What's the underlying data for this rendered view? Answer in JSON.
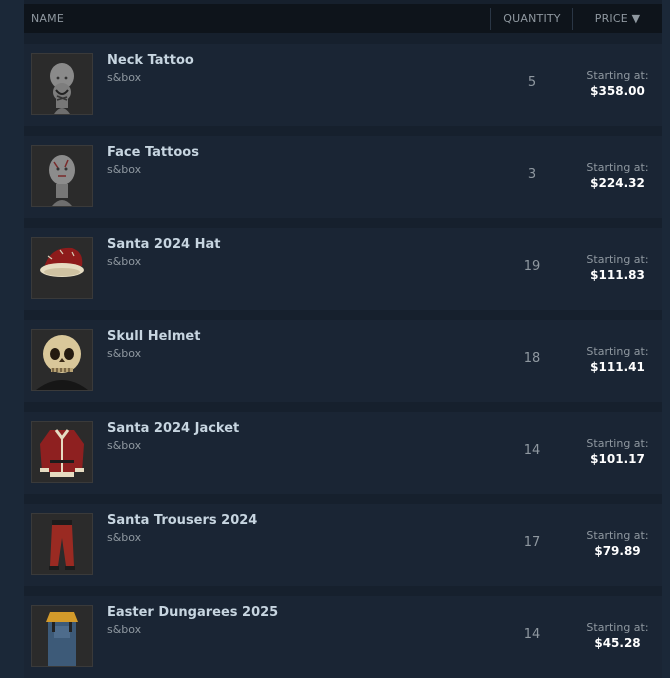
{
  "header": {
    "name": "NAME",
    "quantity": "QUANTITY",
    "price": "PRICE",
    "sort_indicator": "▼"
  },
  "price_label": "Starting at:",
  "items": [
    {
      "name": "Neck Tattoo",
      "game": "s&box",
      "quantity": "5",
      "price": "$358.00",
      "icon": "neck-tattoo-head"
    },
    {
      "name": "Face Tattoos",
      "game": "s&box",
      "quantity": "3",
      "price": "$224.32",
      "icon": "face-tattoo-head"
    },
    {
      "name": "Santa 2024 Hat",
      "game": "s&box",
      "quantity": "19",
      "price": "$111.83",
      "icon": "santa-hat"
    },
    {
      "name": "Skull Helmet",
      "game": "s&box",
      "quantity": "18",
      "price": "$111.41",
      "icon": "skull-helmet"
    },
    {
      "name": "Santa 2024 Jacket",
      "game": "s&box",
      "quantity": "14",
      "price": "$101.17",
      "icon": "santa-jacket"
    },
    {
      "name": "Santa Trousers 2024",
      "game": "s&box",
      "quantity": "17",
      "price": "$79.89",
      "icon": "santa-trousers"
    },
    {
      "name": "Easter Dungarees 2025",
      "game": "s&box",
      "quantity": "14",
      "price": "$45.28",
      "icon": "dungarees"
    }
  ]
}
